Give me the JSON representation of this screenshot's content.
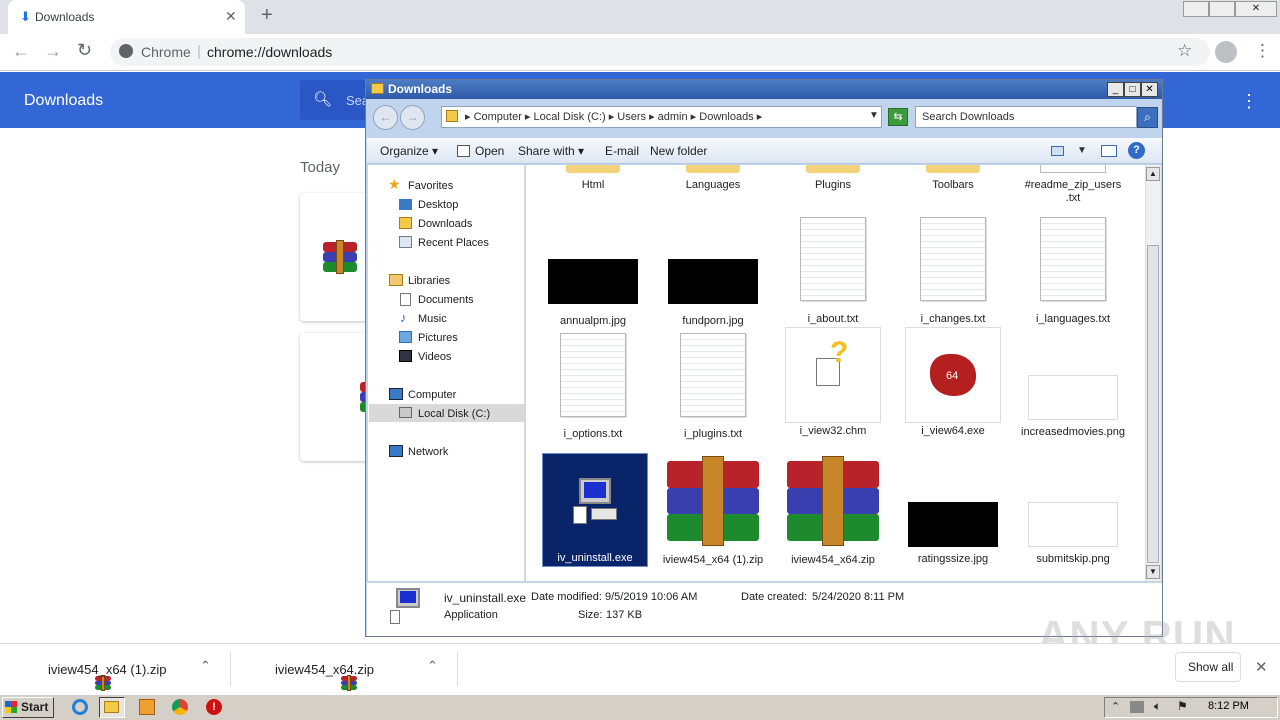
{
  "browser": {
    "tab_title": "Downloads",
    "omnibox_site": "Chrome",
    "omnibox_url": "chrome://downloads",
    "page_title": "Downloads",
    "search_placeholder": "Sea",
    "section_today": "Today"
  },
  "explorer": {
    "title": "Downloads",
    "breadcrumb": [
      "Computer",
      "Local Disk (C:)",
      "Users",
      "admin",
      "Downloads"
    ],
    "search_placeholder": "Search Downloads",
    "commands": [
      "Organize",
      "Open",
      "Share with",
      "E-mail",
      "New folder"
    ],
    "nav": {
      "favorites": "Favorites",
      "desktop": "Desktop",
      "downloads": "Downloads",
      "recent": "Recent Places",
      "libraries": "Libraries",
      "documents": "Documents",
      "music": "Music",
      "pictures": "Pictures",
      "videos": "Videos",
      "computer": "Computer",
      "local_disk": "Local Disk (C:)",
      "network": "Network"
    },
    "files": {
      "html": "Html",
      "languages": "Languages",
      "plugins": "Plugins",
      "toolbars": "Toolbars",
      "readme": "#readme_zip_users .txt",
      "annualpm": "annualpm.jpg",
      "fundporn": "fundporn.jpg",
      "i_about": "i_about.txt",
      "i_changes": "i_changes.txt",
      "i_languages": "i_languages.txt",
      "i_options": "i_options.txt",
      "i_plugins": "i_plugins.txt",
      "i_view32": "i_view32.chm",
      "i_view64": "i_view64.exe",
      "increasedmovies": "increasedmovies.png",
      "iv_uninstall": "iv_uninstall.exe",
      "iview_x64_1": "iview454_x64 (1).zip",
      "iview_x64": "iview454_x64.zip",
      "ratingssize": "ratingssize.jpg",
      "submitskip": "submitskip.png",
      "i_view64_badge": "64"
    },
    "details": {
      "name": "iv_uninstall.exe",
      "type": "Application",
      "modified_label": "Date modified:",
      "modified": "9/5/2019 10:06 AM",
      "created_label": "Date created:",
      "created": "5/24/2020 8:11 PM",
      "size_label": "Size:",
      "size": "137 KB"
    }
  },
  "shelf": {
    "item1": "iview454_x64 (1).zip",
    "item2": "iview454_x64.zip",
    "show_all": "Show all"
  },
  "taskbar": {
    "start": "Start",
    "clock": "8:12 PM"
  },
  "watermark": "ANY RUN"
}
